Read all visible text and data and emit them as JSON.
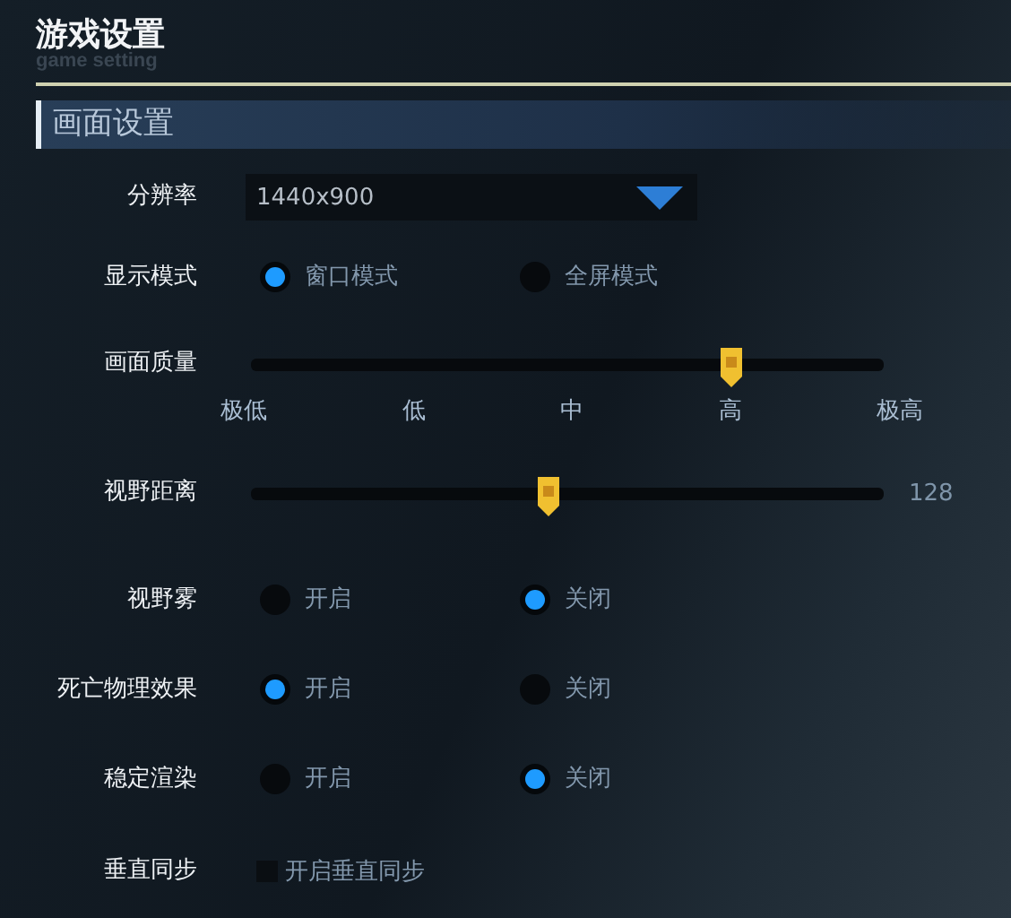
{
  "title": "游戏设置",
  "subtitle": "game setting",
  "section": "画面设置",
  "settings": [
    {
      "kind": "select",
      "label": "分辨率",
      "value": "1440x900"
    },
    {
      "kind": "radio",
      "label": "显示模式",
      "options": [
        {
          "label": "窗口模式",
          "selected": true
        },
        {
          "label": "全屏模式",
          "selected": false
        }
      ]
    },
    {
      "kind": "slider",
      "label": "画面质量",
      "level": 0.76,
      "ticks": [
        "极低",
        "低",
        "中",
        "高",
        "极高"
      ]
    },
    {
      "kind": "slider",
      "label": "视野距离",
      "level": 0.47,
      "reading": "128"
    },
    {
      "kind": "radio",
      "label": "视野雾",
      "options": [
        {
          "label": "开启",
          "selected": false
        },
        {
          "label": "关闭",
          "selected": true
        }
      ]
    },
    {
      "kind": "radio",
      "label": "死亡物理效果",
      "options": [
        {
          "label": "开启",
          "selected": true
        },
        {
          "label": "关闭",
          "selected": false
        }
      ]
    },
    {
      "kind": "radio",
      "label": "稳定渲染",
      "options": [
        {
          "label": "开启",
          "selected": false
        },
        {
          "label": "关闭",
          "selected": true
        }
      ]
    },
    {
      "kind": "checkbox",
      "label": "垂直同步",
      "option": "开启垂直同步",
      "checked": false
    }
  ]
}
